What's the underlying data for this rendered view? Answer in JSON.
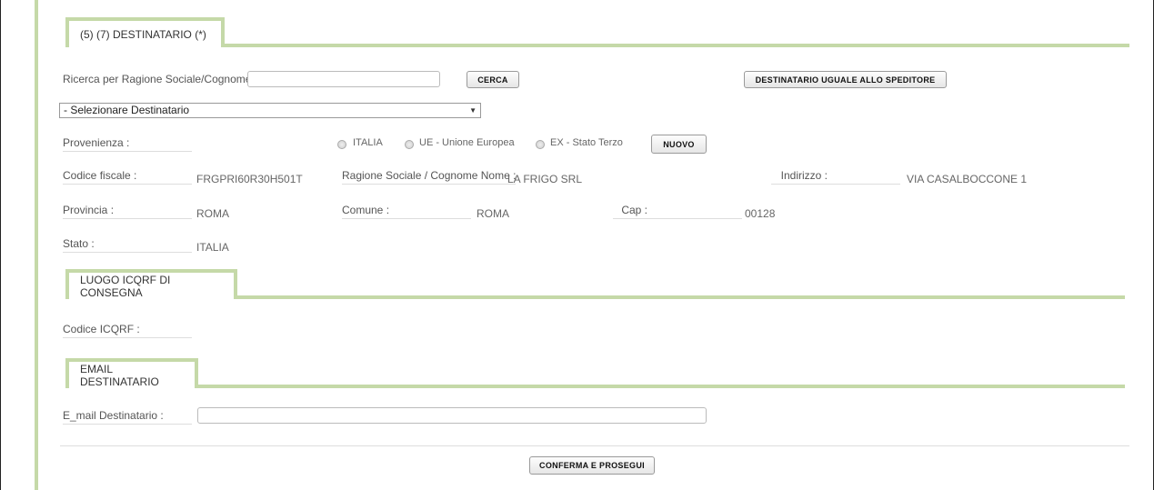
{
  "sections": {
    "destinatario": {
      "title": "(5) (7) DESTINATARIO (*)"
    },
    "luogo": {
      "title": "LUOGO ICQRF DI CONSEGNA"
    },
    "email": {
      "title": "EMAIL DESTINATARIO"
    }
  },
  "search": {
    "label": "Ricerca per Ragione Sociale/Cognome:",
    "value": "",
    "button": "CERCA",
    "same_as_sender_button": "DESTINATARIO UGUALE ALLO SPEDITORE"
  },
  "select_destinatario": {
    "selected": "- Selezionare Destinatario"
  },
  "provenienza": {
    "label": "Provenienza :",
    "options": [
      "ITALIA",
      "UE - Unione Europea",
      "EX - Stato Terzo"
    ],
    "new_button": "NUOVO"
  },
  "fields": {
    "codice_fiscale": {
      "label": "Codice fiscale :",
      "value": "FRGPRI60R30H501T"
    },
    "ragione_sociale": {
      "label": "Ragione Sociale / Cognome Nome :",
      "value": "LA FRIGO SRL"
    },
    "indirizzo": {
      "label": "Indirizzo :",
      "value": "VIA CASALBOCCONE 1"
    },
    "provincia": {
      "label": "Provincia :",
      "value": "ROMA"
    },
    "comune": {
      "label": "Comune :",
      "value": "ROMA"
    },
    "cap": {
      "label": "Cap :",
      "value": "00128"
    },
    "stato": {
      "label": "Stato :",
      "value": "ITALIA"
    },
    "codice_icqrf": {
      "label": "Codice ICQRF :",
      "value": ""
    },
    "email": {
      "label": "E_mail Destinatario :",
      "value": ""
    }
  },
  "footer": {
    "confirm_button": "CONFERMA E PROSEGUI"
  },
  "colors": {
    "accent_green": "#c5d9a8",
    "frame": "#222222"
  }
}
